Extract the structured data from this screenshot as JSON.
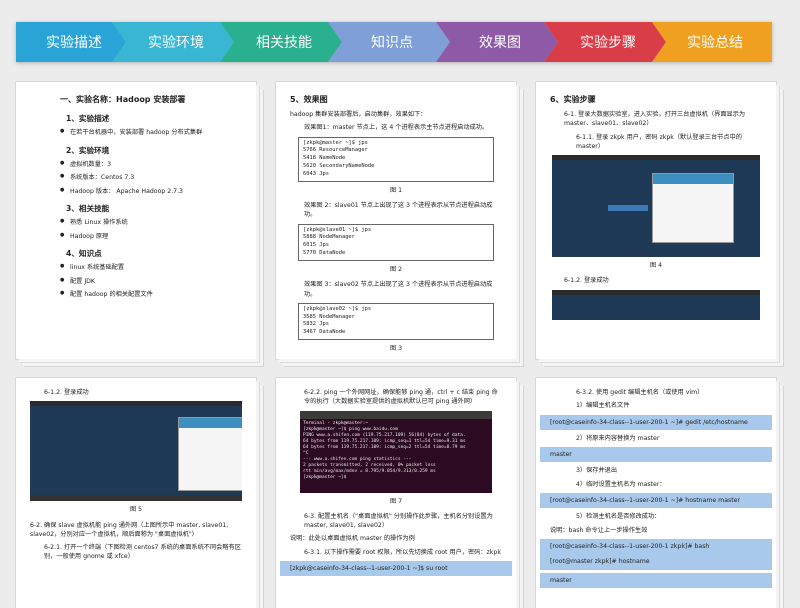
{
  "tabs": [
    {
      "label": "实验描述",
      "color": "#2aa3d6"
    },
    {
      "label": "实验环境",
      "color": "#38b6d3"
    },
    {
      "label": "相关技能",
      "color": "#2ab08f"
    },
    {
      "label": "知识点",
      "color": "#7f9fd8"
    },
    {
      "label": "效果图",
      "color": "#8e5aa8"
    },
    {
      "label": "实验步骤",
      "color": "#d93d47"
    },
    {
      "label": "实验总结",
      "color": "#f0a020"
    }
  ],
  "card1": {
    "title": "一、实验名称：Hadoop 安装部署",
    "s1": "1、实验描述",
    "s1_item": "在若干台机器中，安装部署 hadoop 分布式集群",
    "s2": "2、实验环境",
    "s2_items": [
      "虚拟机数量：3",
      "系统版本：Centos 7.3",
      "Hadoop 版本： Apache Hadoop 2.7.3"
    ],
    "s3": "3、相关技能",
    "s3_items": [
      "熟悉 Linux 操作系统",
      "Hadoop 原理"
    ],
    "s4": "4、知识点",
    "s4_items": [
      "linux 系统基础配置",
      "配置 JDK",
      "配置 hadoop 的相关配置文件"
    ]
  },
  "card2": {
    "title": "5、效果图",
    "intro": "hadoop 集群安装部署后，启动集群，效果如下：",
    "d1": "效果图1：master 节点上，这 4 个进程表示主节点进程启动成功。",
    "code1": "[zkpk@master ~]$ jps\n5766 ResourceManager\n5418 NameNode\n5620 SecondaryNameNode\n6043 Jps",
    "cap1": "图 1",
    "d2": "效果图 2：slave01 节点上出现了这 3 个进程表示从节点进程启动成功。",
    "code2": "[zkpk@slave01 ~]$ jps\n5888 NodeManager\n6015 Jps\n5770 DataNode",
    "cap2": "图 2",
    "d3": "效果图 3：slave02 节点上出现了这 3 个进程表示从节点进程启动成功。",
    "code3": "[zkpk@slave02 ~]$ jps\n3585 NodeManager\n5832 Jps\n3467 DataNode",
    "cap3": "图 3"
  },
  "card3": {
    "title": "6、实验步骤",
    "p1": "6-1. 登录大数据实验室，进入实验，打开三台虚拟机（界面显示为 master、slave01、slave02）",
    "p2": "6-1.1. 登录 zkpk 用户，密码 zkpk（默认登录三台节点中的 master）",
    "cap": "图 4",
    "p3": "6-1.2. 登录成功"
  },
  "card4": {
    "p1": "6-1.2. 登录成功",
    "cap": "图 5",
    "p2": "6-2. 确保 slave 虚拟机能 ping 通外网（上图所示中 master, slave01, slave02，分别对应一个虚拟机，顺后面称为 \"桌面虚拟机\"）",
    "p3": "6-2.1. 打开一个终端（下图检测 centos7 系统的桌面系统不同会略有区别，一般使用 gnome 或 xfce）"
  },
  "card5": {
    "p1": "6-2.2. ping 一个外网网址，确保能够 ping 通，ctrl + c 结束 ping 命令的执行（大数据实验室提供的虚拟机默认已可 ping 通外网）",
    "term": "Terminal - zkpk@master:~\n[zkpk@master ~]$ ping www.baidu.com\nPING www.a.shifen.com (119.75.217.109) 56(84) bytes of data.\n64 bytes from 119.75.217.109: icmp_seq=1 ttl=54 time=9.31 ms\n64 bytes from 119.75.217.109: icmp_seq=2 ttl=54 time=8.79 ms\n^C\n--- www.a.shifen.com ping statistics ---\n2 packets transmitted, 2 received, 0% packet loss\nrtt min/avg/max/mdev = 8.795/9.054/9.313/0.259 ms\n[zkpk@master ~]$",
    "cap": "图 7",
    "p2": "6-3. 配置主机名（\"桌面虚拟机\" 分别操作此步骤，主机名分别设置为 master, slave01, slave02）",
    "p3": "说明：此处以桌面虚拟机 master 的操作为例",
    "p4": "6-3.1. 以下操作需要 root 权限，所以先切换成 root 用户，密码：zkpk",
    "cmd": "[zkpk@caseinfo-34-class--1-user-200-1 ~]$ su root"
  },
  "card6": {
    "p1": "6-3.2. 使用 gedit 编辑主机名（或使用 vim）",
    "p2": "1）编辑主机名文件",
    "cmd1": "[root@caseinfo-34-class--1-user-200-1 ~]# gedit /etc/hostname",
    "p3": "2）将原来内容替换为 master",
    "cmd2": "master",
    "p4": "3）保存并退出",
    "p5": "4）临时设置主机名为 master：",
    "cmd3": "[root@caseinfo-34-class--1-user-200-1 ~]# hostname master",
    "p6": "5）检测主机名是否修改成功：",
    "p7": "说明：bash 命令让上一步操作生效",
    "cmd4a": "[root@caseinfo-34-class--1-user-200-1 zkpk]# bash",
    "cmd4b": "[root@master zkpk]# hostname",
    "cmd5": "master"
  }
}
